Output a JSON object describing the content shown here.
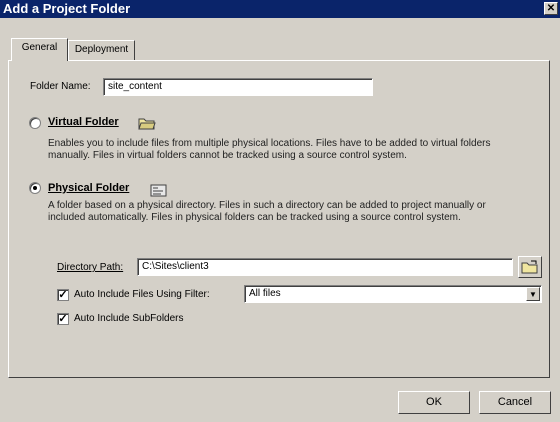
{
  "dialog": {
    "title": "Add a Project Folder",
    "close_glyph": "✕"
  },
  "tabs": [
    {
      "label": "General",
      "active": true
    },
    {
      "label": "Deployment",
      "active": false
    }
  ],
  "folder_name": {
    "label": "Folder Name:",
    "value": "site_content"
  },
  "virtual_folder": {
    "label": "Virtual Folder",
    "selected": false,
    "description_line1": "Enables you to include files from multiple physical locations. Files have to be added to virtual folders",
    "description_line2": "manually. Files in virtual folders cannot be tracked using a source control system."
  },
  "physical_folder": {
    "label": "Physical Folder",
    "selected": true,
    "description_line1": "A folder based on a physical directory. Files in such a directory can be added to project manually or",
    "description_line2": "included automatically. Files in physical folders can be tracked using a source control system."
  },
  "directory_path": {
    "label": "Directory Path:",
    "value": "C:\\Sites\\client3"
  },
  "auto_include_filter": {
    "label": "Auto Include Files Using Filter:",
    "checked": true,
    "value": "All files"
  },
  "auto_include_subfolders": {
    "label": "Auto Include SubFolders",
    "checked": true
  },
  "buttons": {
    "ok": "OK",
    "cancel": "Cancel"
  },
  "check_glyph": "✓",
  "dropdown_glyph": "▼"
}
